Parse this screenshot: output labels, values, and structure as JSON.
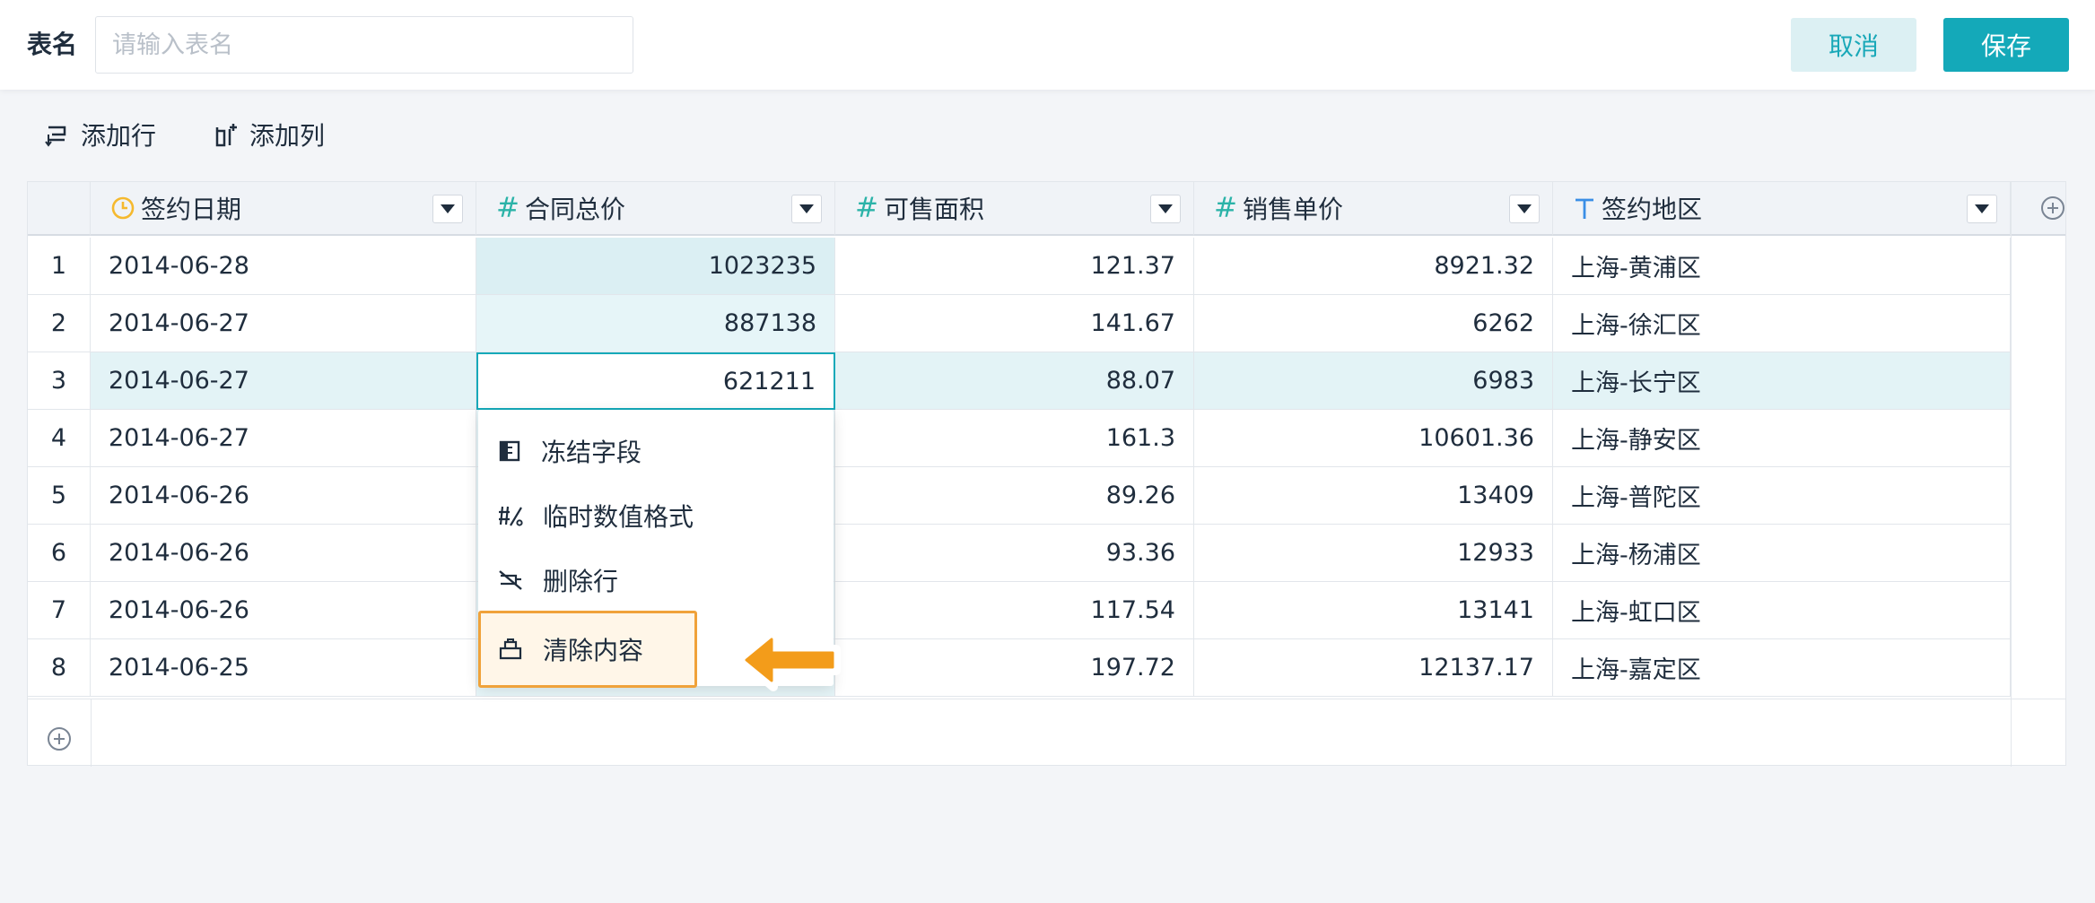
{
  "header": {
    "name_label": "表名",
    "name_placeholder": "请输入表名",
    "cancel_label": "取消",
    "save_label": "保存"
  },
  "toolbar": {
    "add_row_label": "添加行",
    "add_col_label": "添加列"
  },
  "table": {
    "columns": [
      {
        "label": "签约日期",
        "type_icon": "clock-icon",
        "type_color": "#f5b92e"
      },
      {
        "label": "合同总价",
        "type_icon": "hash-icon",
        "type_color": "#2bb3a8"
      },
      {
        "label": "可售面积",
        "type_icon": "hash-icon",
        "type_color": "#2bb3a8"
      },
      {
        "label": "销售单价",
        "type_icon": "hash-icon",
        "type_color": "#2bb3a8"
      },
      {
        "label": "签约地区",
        "type_icon": "text-type-icon",
        "type_color": "#3a8ee6"
      }
    ],
    "rows": [
      {
        "idx": "1",
        "date": "2014-06-28",
        "total": "1023235",
        "area": "121.37",
        "price": "8921.32",
        "region": "上海-黄浦区"
      },
      {
        "idx": "2",
        "date": "2014-06-27",
        "total": "887138",
        "area": "141.67",
        "price": "6262",
        "region": "上海-徐汇区"
      },
      {
        "idx": "3",
        "date": "2014-06-27",
        "total": "621211",
        "area": "88.07",
        "price": "6983",
        "region": "上海-长宁区"
      },
      {
        "idx": "4",
        "date": "2014-06-27",
        "total": "",
        "area": "161.3",
        "price": "10601.36",
        "region": "上海-静安区"
      },
      {
        "idx": "5",
        "date": "2014-06-26",
        "total": "",
        "area": "89.26",
        "price": "13409",
        "region": "上海-普陀区"
      },
      {
        "idx": "6",
        "date": "2014-06-26",
        "total": "",
        "area": "93.36",
        "price": "12933",
        "region": "上海-杨浦区"
      },
      {
        "idx": "7",
        "date": "2014-06-26",
        "total": "",
        "area": "117.54",
        "price": "13141",
        "region": "上海-虹口区"
      },
      {
        "idx": "8",
        "date": "2014-06-25",
        "total": "",
        "area": "197.72",
        "price": "12137.17",
        "region": "上海-嘉定区"
      }
    ]
  },
  "context_menu": {
    "items": [
      {
        "label": "冻结字段",
        "icon": "freeze-column-icon"
      },
      {
        "label": "临时数值格式",
        "icon": "number-format-icon"
      },
      {
        "label": "删除行",
        "icon": "delete-row-icon"
      },
      {
        "label": "清除内容",
        "icon": "clear-content-icon"
      }
    ]
  },
  "colors": {
    "accent": "#14a9b9",
    "highlight_border": "#f0a23a",
    "arrow": "#f39c1a"
  }
}
